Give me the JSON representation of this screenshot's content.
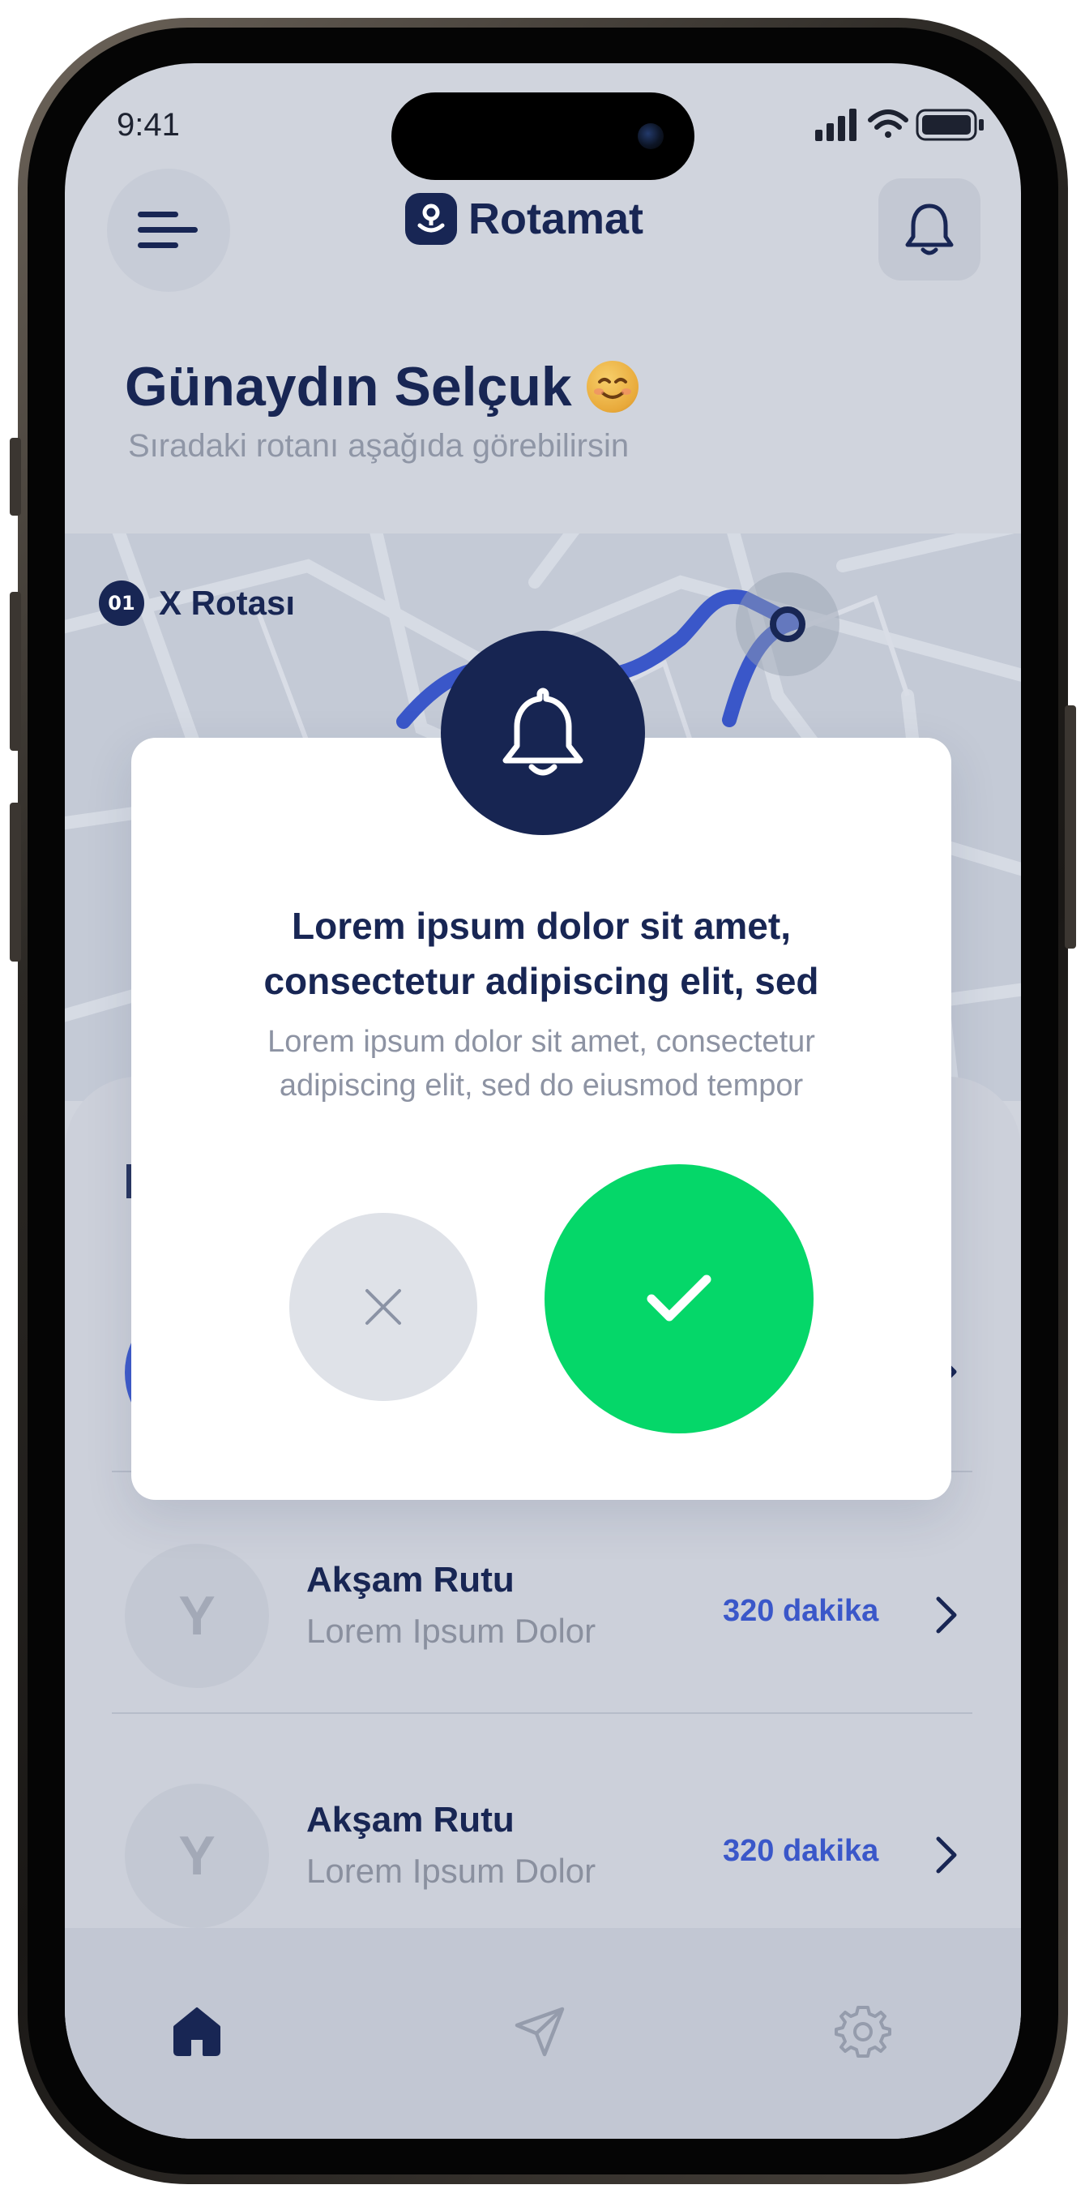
{
  "status": {
    "time": "9:41"
  },
  "header": {
    "app_name": "Rotamat"
  },
  "greeting": {
    "title": "Günaydın Selçuk",
    "subtitle": "Sıradaki rotanı aşağıda görebilirsin"
  },
  "map": {
    "route_number": "01",
    "route_name": "X Rotası"
  },
  "routes": [
    {
      "avatar_letter": "Y",
      "title": "Akşam Rutu",
      "subtitle": "Lorem Ipsum Dolor",
      "duration": "320 dakika"
    },
    {
      "avatar_letter": "Y",
      "title": "Akşam Rutu",
      "subtitle": "Lorem Ipsum Dolor",
      "duration": "320 dakika"
    }
  ],
  "modal": {
    "title_line1": "Lorem ipsum dolor sit amet,",
    "title_line2": "consectetur adipiscing elit, sed",
    "body_line1": "Lorem ipsum dolor sit amet, consectetur",
    "body_line2": "adipiscing elit, sed do eiusmod tempor"
  },
  "icons": {
    "menu": "menu-icon",
    "notifications": "bell-icon",
    "home": "home-icon",
    "send": "send-icon",
    "settings": "gear-icon",
    "cancel": "close-icon",
    "confirm": "check-icon"
  },
  "colors": {
    "primary": "#182654",
    "accent": "#3a57c9",
    "success": "#05d769",
    "background": "#d0d4dd"
  }
}
